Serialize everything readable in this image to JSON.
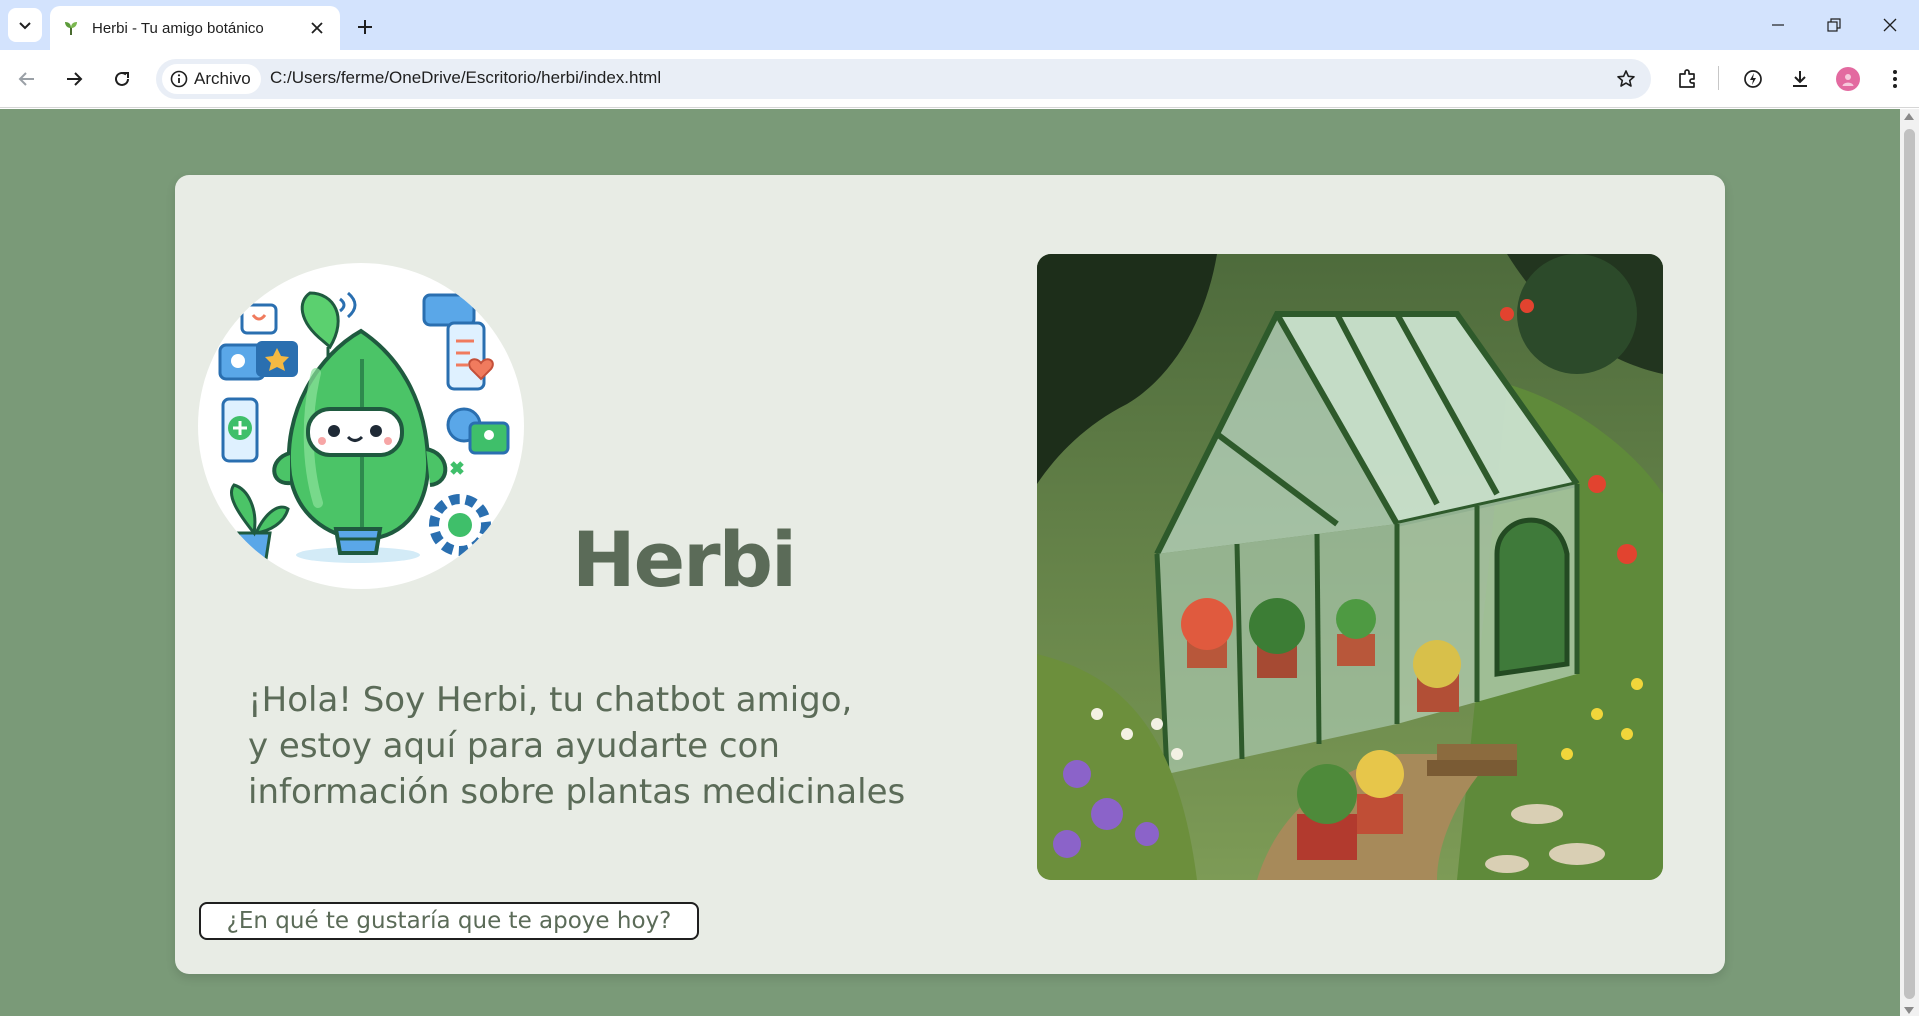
{
  "browser": {
    "tab": {
      "title": "Herbi - Tu amigo botánico"
    },
    "address": {
      "chip_label": "Archivo",
      "url": "C:/Users/ferme/OneDrive/Escritorio/herbi/index.html"
    }
  },
  "page": {
    "brand": "Herbi",
    "intro_lines": [
      "¡Hola! Soy Herbi, tu chatbot amigo,",
      "y estoy aquí para ayudarte con",
      "información sobre plantas medicinales"
    ],
    "cta_label": "¿En qué te gustaría que te apoye hoy?"
  },
  "colors": {
    "background": "#7a9a78",
    "card": "#e8ece5",
    "text": "#5b6b58",
    "chrome": "#d3e3fd"
  },
  "icons": [
    "chevron-down-icon",
    "plant-favicon",
    "close-icon",
    "plus-icon",
    "minimize-icon",
    "restore-icon",
    "back-icon",
    "forward-icon",
    "reload-icon",
    "info-icon",
    "star-icon",
    "extensions-icon",
    "performance-icon",
    "download-icon",
    "profile-avatar",
    "more-icon"
  ]
}
